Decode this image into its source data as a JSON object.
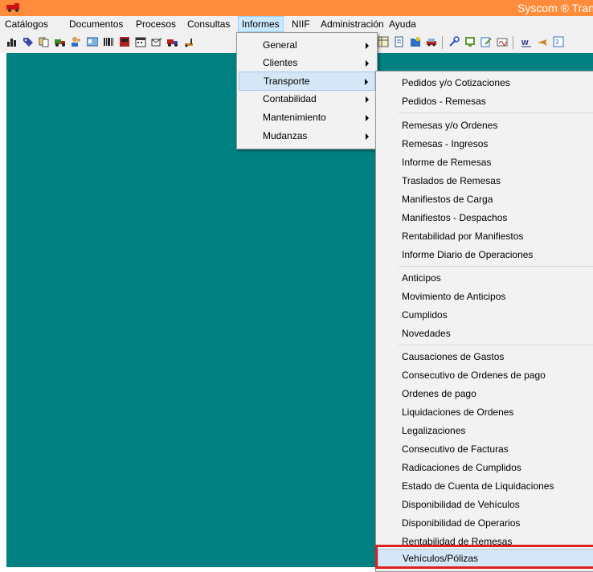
{
  "window": {
    "title": "Syscom ® Tran",
    "accent_color": "#ff8c3a",
    "desktop_color": "#008080"
  },
  "menubar": {
    "items": [
      "Catálogos",
      "Documentos",
      "Procesos",
      "Consultas",
      "Informes",
      "NIIF",
      "Administración",
      "Ayuda"
    ],
    "active": "Informes"
  },
  "informes_menu": {
    "items": [
      "General",
      "Clientes",
      "Transporte",
      "Contabilidad",
      "Mantenimiento",
      "Mudanzas"
    ],
    "highlighted": "Transporte"
  },
  "transporte_menu": {
    "groups": [
      [
        "Pedidos y/o Cotizaciones",
        "Pedidos - Remesas"
      ],
      [
        "Remesas y/o Ordenes",
        "Remesas - Ingresos",
        "Informe de Remesas",
        "Traslados de Remesas",
        "Manifiestos de Carga",
        "Manifiestos - Despachos",
        "Rentabilidad por Manifiestos",
        "Informe Diario de Operaciones"
      ],
      [
        "Anticipos",
        "Movimiento de Anticipos",
        "Cumplidos",
        "Novedades"
      ],
      [
        "Causaciones de Gastos",
        "Consecutivo de Ordenes de pago",
        "Ordenes de pago",
        "Liquidaciones de Ordenes",
        "Legalizaciones",
        "Consecutivo de Facturas",
        "Radicaciones de Cumplidos",
        "Estado de Cuenta de Liquidaciones",
        "Disponibilidad de Vehículos",
        "Disponibilidad de Operarios",
        "Rentabilidad de Remesas",
        "Vehículos/Pólizas"
      ]
    ],
    "highlighted": "Vehículos/Pólizas"
  },
  "toolbar_icons": [
    "chart-icon",
    "tag-icon",
    "cards-icon",
    "truck-icon",
    "people-icon",
    "id-card-icon",
    "barcode-icon",
    "book-icon",
    "calendar-icon",
    "envelope-icon",
    "delivery-truck-icon",
    "forklift-icon",
    "table-icon",
    "document-icon",
    "folder-icon",
    "car-icon",
    "tools-icon",
    "note-icon",
    "edit-icon",
    "signature-icon",
    "w-icon",
    "plane-icon",
    "calc-icon"
  ]
}
